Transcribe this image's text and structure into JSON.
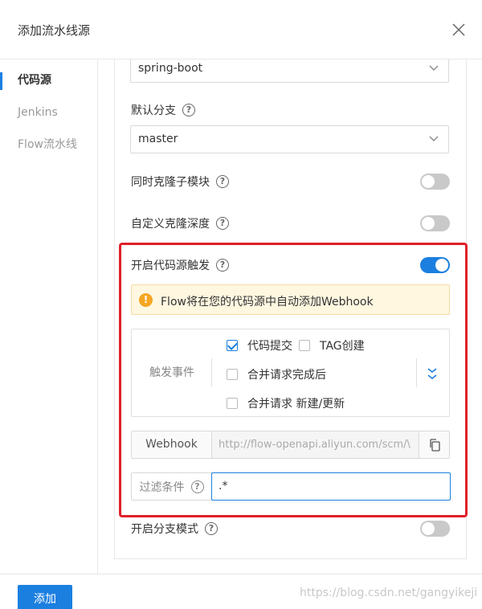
{
  "dialog": {
    "title": "添加流水线源"
  },
  "sidebar": {
    "items": [
      {
        "label": "代码源",
        "active": true
      },
      {
        "label": "Jenkins",
        "active": false
      },
      {
        "label": "Flow流水线",
        "active": false
      }
    ]
  },
  "form": {
    "repo_select": {
      "value": "spring-boot"
    },
    "default_branch": {
      "label": "默认分支",
      "help": "?",
      "value": "master"
    },
    "clone_submodules": {
      "label": "同时克隆子模块",
      "help": "?",
      "enabled": false
    },
    "custom_clone_depth": {
      "label": "自定义克隆深度",
      "help": "?",
      "enabled": false
    },
    "enable_trigger": {
      "label": "开启代码源触发",
      "help": "?",
      "enabled": true
    },
    "notice": {
      "icon": "!",
      "text": "Flow将在您的代码源中自动添加Webhook"
    },
    "trigger_events": {
      "label": "触发事件",
      "options": [
        {
          "label": "代码提交",
          "checked": true
        },
        {
          "label": "TAG创建",
          "checked": false
        },
        {
          "label": "合并请求完成后",
          "checked": false
        },
        {
          "label": "合并请求 新建/更新",
          "checked": false
        }
      ]
    },
    "webhook": {
      "label": "Webhook",
      "value": "http://flow-openapi.aliyun.com/scm/\\"
    },
    "filter": {
      "label": "过滤条件",
      "help": "?",
      "value": ".*"
    },
    "branch_mode": {
      "label": "开启分支模式",
      "help": "?",
      "enabled": false
    }
  },
  "footer": {
    "add_label": "添加"
  },
  "watermark": "https://blog.csdn.net/gangyikeji",
  "colors": {
    "primary": "#1b7fe0",
    "highlight": "#e0202a",
    "warning": "#f5a623"
  }
}
